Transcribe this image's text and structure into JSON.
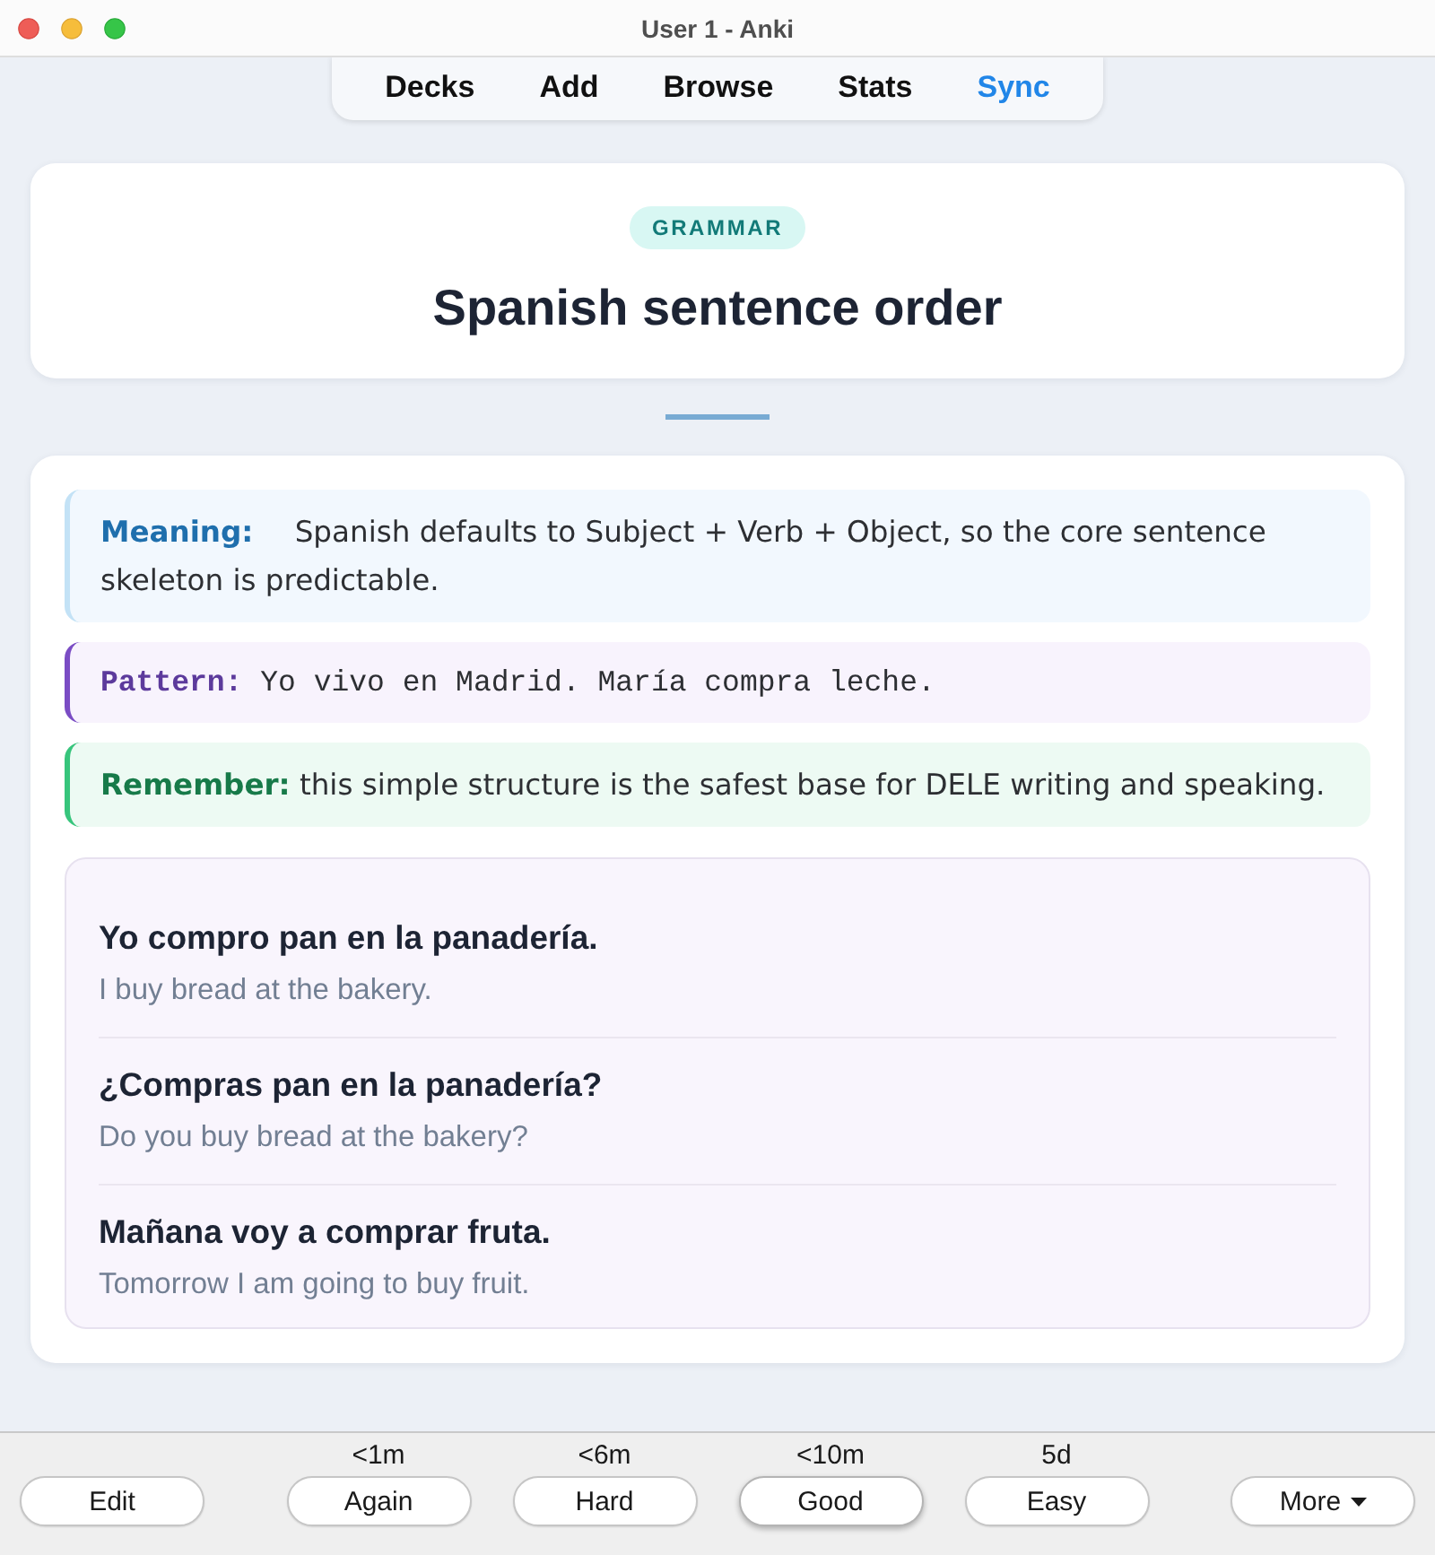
{
  "window": {
    "title": "User 1 - Anki"
  },
  "toolbar": {
    "items": [
      {
        "label": "Decks",
        "highlighted": false
      },
      {
        "label": "Add",
        "highlighted": false
      },
      {
        "label": "Browse",
        "highlighted": false
      },
      {
        "label": "Stats",
        "highlighted": false
      },
      {
        "label": "Sync",
        "highlighted": true
      }
    ]
  },
  "card": {
    "tag": "GRAMMAR",
    "title": "Spanish sentence order",
    "notes": [
      {
        "kind": "meaning",
        "label": "Meaning:",
        "text": "Spanish defaults to Subject + Verb + Object, so the core sentence skeleton is predictable."
      },
      {
        "kind": "pattern",
        "label": "Pattern:",
        "text": "Yo vivo en Madrid. María compra leche."
      },
      {
        "kind": "remember",
        "label": "Remember:",
        "text": "this simple structure is the safest base for DELE writing and speaking."
      }
    ],
    "examples": [
      {
        "spanish": "Yo compro pan en la panadería.",
        "english": "I buy bread at the bakery."
      },
      {
        "spanish": "¿Compras pan en la panadería?",
        "english": "Do you buy bread at the bakery?"
      },
      {
        "spanish": "Mañana voy a comprar fruta.",
        "english": "Tomorrow I am going to buy fruit."
      }
    ]
  },
  "answer_bar": {
    "edit": "Edit",
    "answers": [
      {
        "interval": "<1m",
        "label": "Again",
        "default": false
      },
      {
        "interval": "<6m",
        "label": "Hard",
        "default": false
      },
      {
        "interval": "<10m",
        "label": "Good",
        "default": true
      },
      {
        "interval": "5d",
        "label": "Easy",
        "default": false
      }
    ],
    "more": "More"
  }
}
